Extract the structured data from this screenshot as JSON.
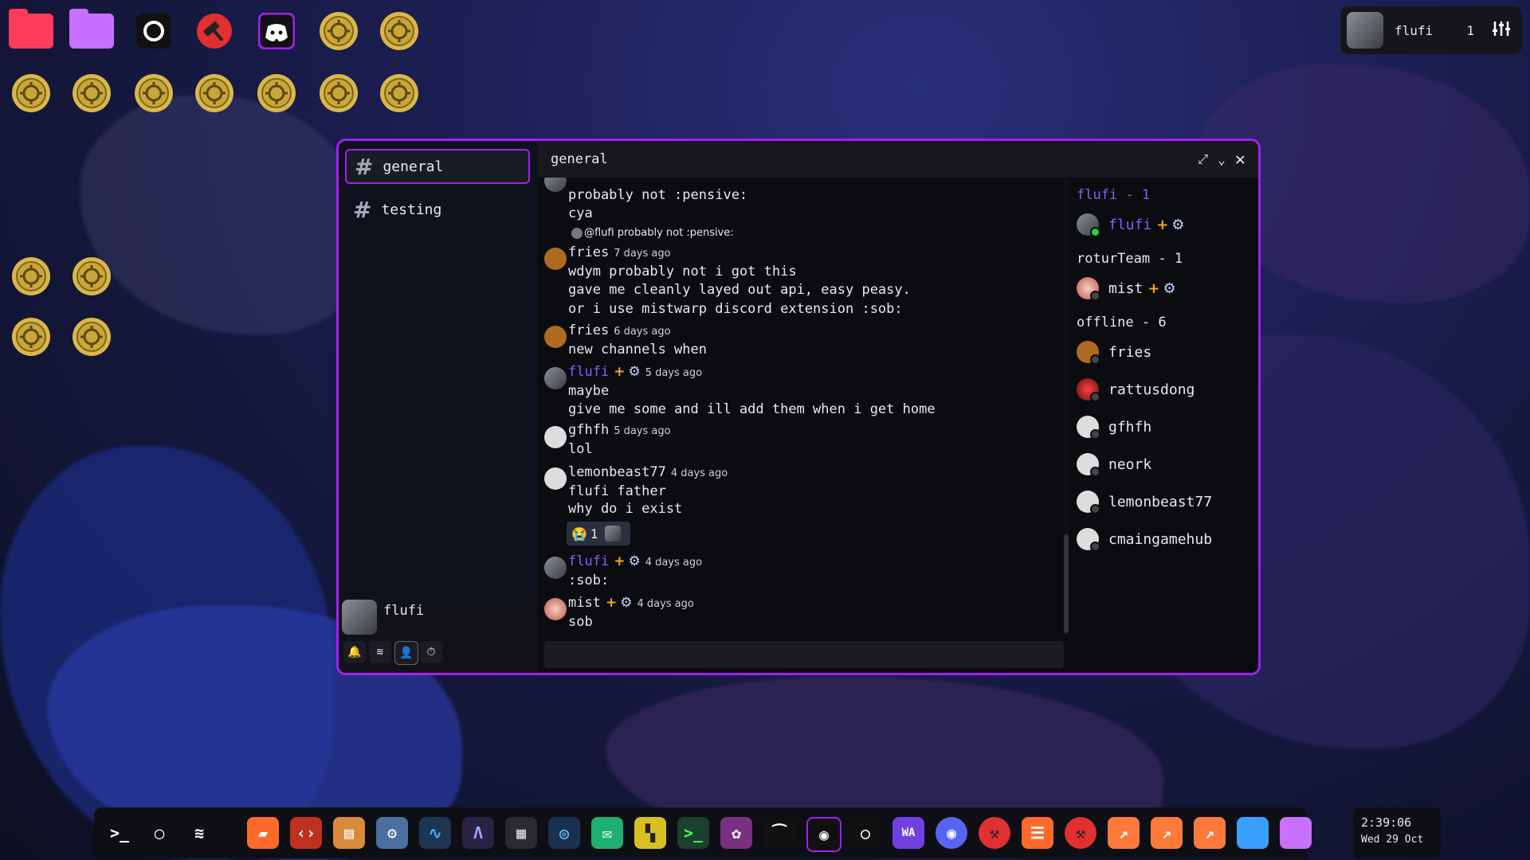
{
  "top_panel": {
    "username": "flufi",
    "count": "1"
  },
  "window": {
    "channels": [
      {
        "label": "general",
        "active": true
      },
      {
        "label": "testing",
        "active": false
      }
    ],
    "header_title": "general",
    "user": {
      "name": "flufi"
    },
    "messages": [
      {
        "lines": [
          "probably not :pensive:",
          "cya"
        ]
      },
      {
        "reply_preview": "@flufi probably not :pensive:"
      },
      {
        "author": "fries",
        "time": "7 days ago",
        "lines": [
          "wdym probably not i got this",
          "gave me cleanly layed out api, easy peasy.",
          "or i use mistwarp discord extension :sob:"
        ]
      },
      {
        "author": "fries",
        "time": "6 days ago",
        "lines": [
          "new channels when"
        ]
      },
      {
        "author": "flufi",
        "time": "5 days ago",
        "lines": [
          "maybe",
          "give me some and ill add them when i get home"
        ]
      },
      {
        "author": "gfhfh",
        "time": "5 days ago",
        "lines": [
          "lol"
        ]
      },
      {
        "author": "lemonbeast77",
        "time": "4 days ago",
        "lines": [
          "flufi father",
          "why do i exist"
        ],
        "reaction_count": "1"
      },
      {
        "author": "flufi",
        "time": "4 days ago",
        "lines": [
          ":sob:"
        ]
      },
      {
        "author": "mist",
        "time": "4 days ago",
        "lines": [
          "sob"
        ]
      }
    ],
    "members": {
      "group1": "flufi - 1",
      "group1_members": [
        "flufi"
      ],
      "group2": "roturTeam - 1",
      "group2_members": [
        "mist"
      ],
      "group3": "offline - 6",
      "offline": [
        "fries",
        "rattusdong",
        "gfhfh",
        "neork",
        "lemonbeast77",
        "cmaingamehub"
      ]
    }
  },
  "clock": {
    "time": "2:39:06",
    "date": "Wed 29 Oct"
  },
  "colors": {
    "accent": "#a020f0",
    "name_purple": "#8a5cff",
    "plus": "#f5a623"
  }
}
